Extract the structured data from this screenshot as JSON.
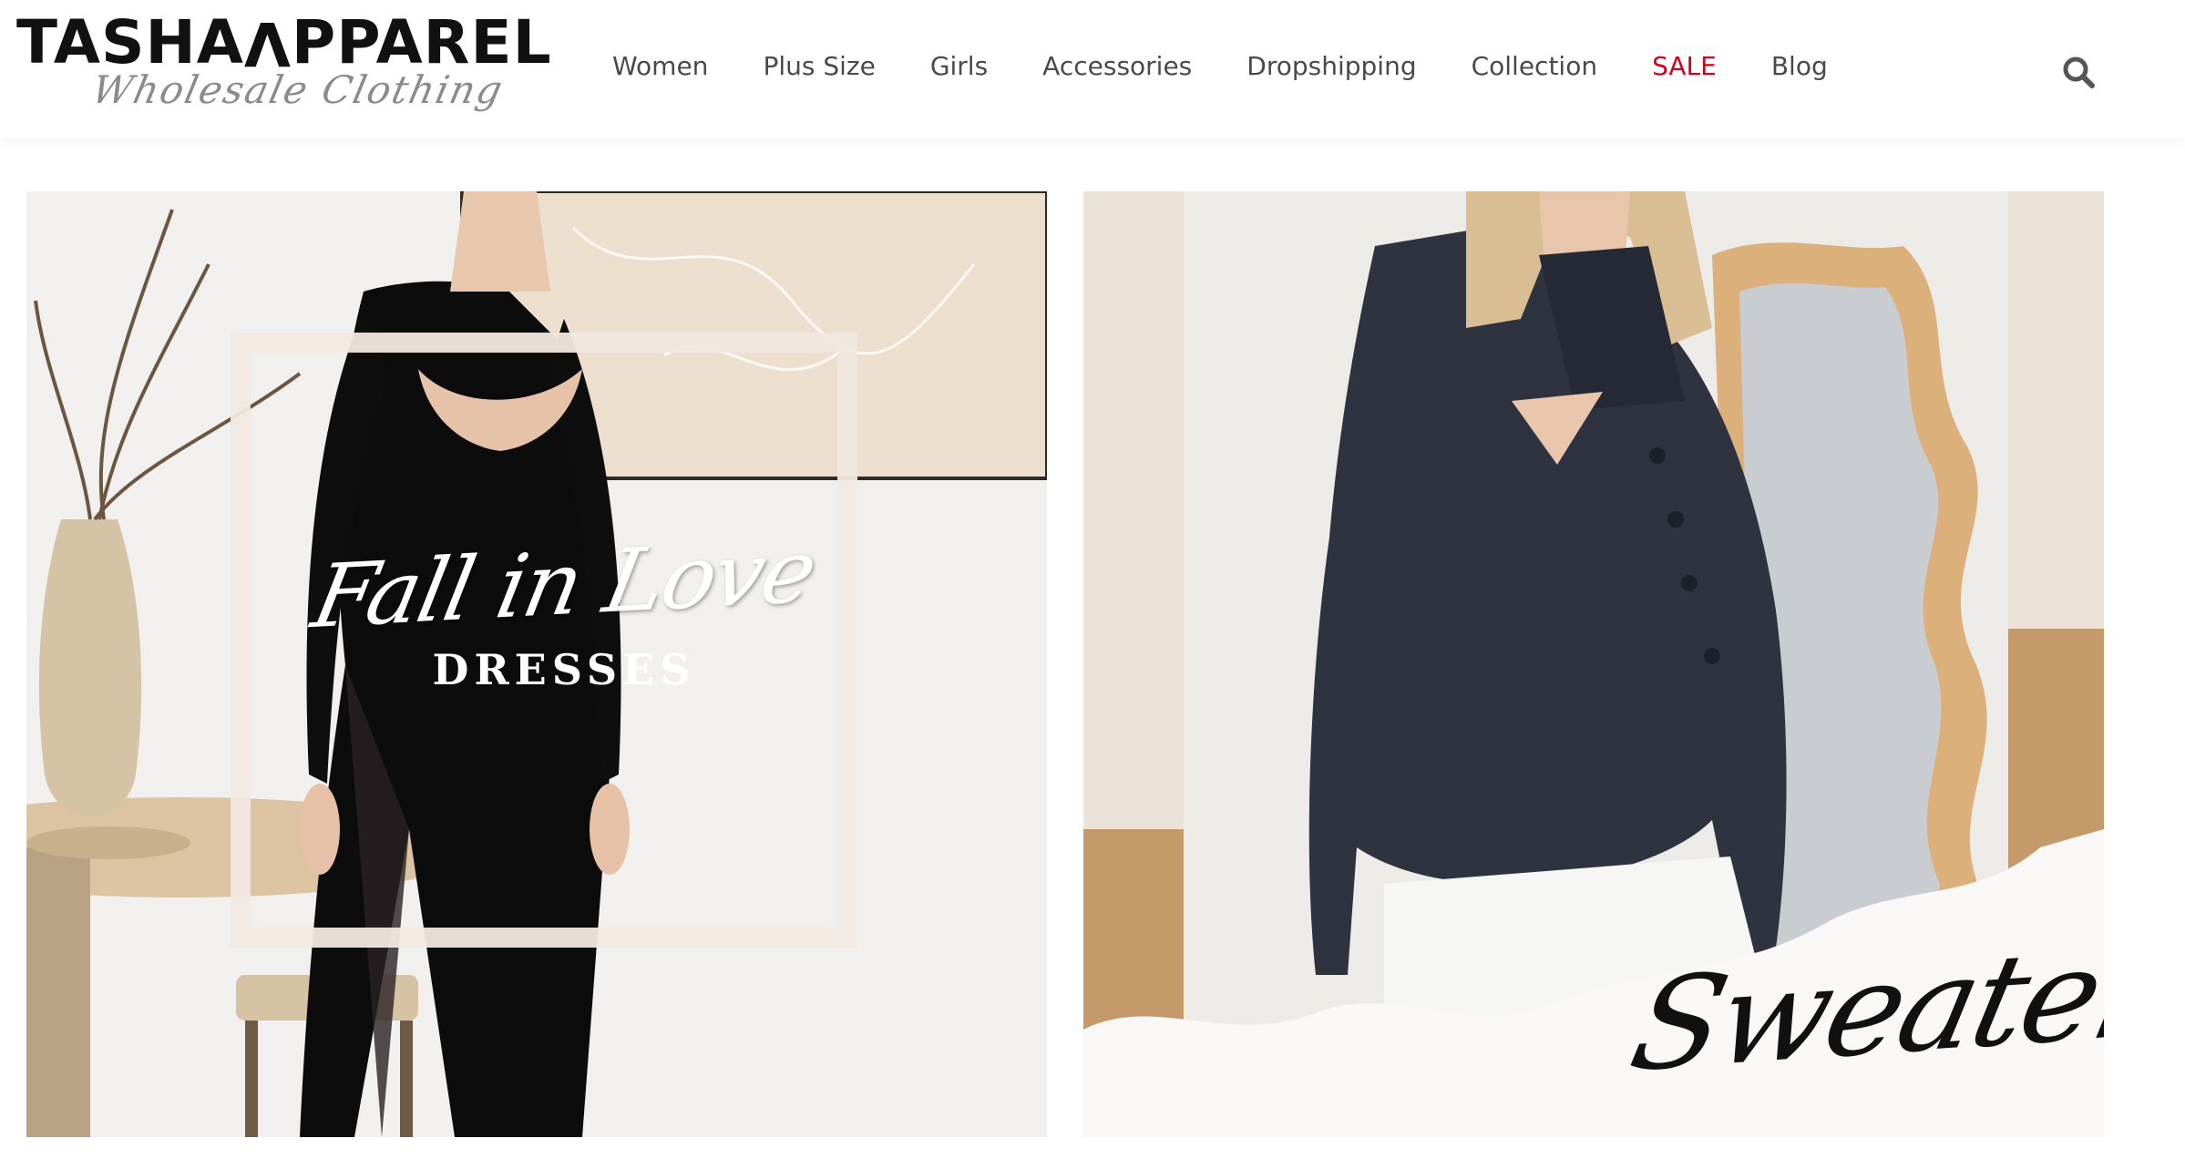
{
  "header": {
    "logo_main": "TASHA",
    "logo_flip": "V",
    "logo_end": "PPAREL",
    "logo_sub": "Wholesale Clothing",
    "search_icon": "search-icon"
  },
  "nav": {
    "items": [
      {
        "label": "Women"
      },
      {
        "label": "Plus Size"
      },
      {
        "label": "Girls"
      },
      {
        "label": "Accessories"
      },
      {
        "label": "Dropshipping"
      },
      {
        "label": "Collection"
      },
      {
        "label": "SALE"
      },
      {
        "label": "Blog"
      }
    ]
  },
  "banners": {
    "left": {
      "script": "Fall in Love",
      "caps": "DRESSES"
    },
    "right": {
      "script": "Sweaters"
    }
  },
  "colors": {
    "sale": "#d0021b",
    "nav_text": "#4a4a4a",
    "logo": "#111111"
  }
}
